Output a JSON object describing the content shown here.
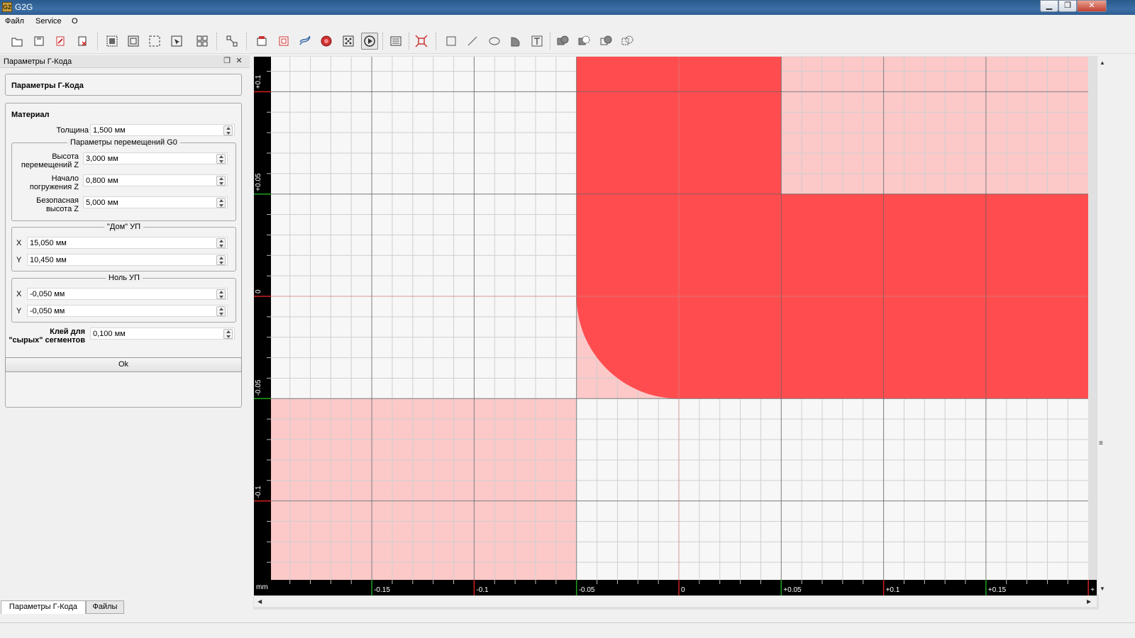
{
  "window": {
    "title": "G2G",
    "icon_text": "G2",
    "minimize": "▁",
    "maximize": "❐",
    "close": "✕"
  },
  "menu": [
    "Файл",
    "Service",
    "О"
  ],
  "toolbar_icons": [
    "open-icon",
    "save-icon",
    "export-icon",
    "delete-icon",
    "select-all-icon",
    "select-frame-icon",
    "select-dashed-icon",
    "select-arrow-icon",
    "group-icon",
    "ungroup-icon",
    "layers-icon",
    "path-icon",
    "tool-path-icon",
    "circle-target-icon",
    "points-icon",
    "gcode-params-icon",
    "properties-icon",
    "fit-view-icon",
    "rectangle-icon",
    "line-icon",
    "ellipse-icon",
    "arc-shape-icon",
    "text-icon",
    "union-icon",
    "subtract-icon",
    "intersect-icon",
    "exclude-icon"
  ],
  "dock": {
    "title": "Параметры Г-Кода",
    "header_group": "Параметры Г-Кода",
    "material": {
      "title": "Материал",
      "thickness_label": "Толщина",
      "thickness_value": "1,500 мм",
      "g0": {
        "title": "Параметры перемещений G0",
        "travel_label_1": "Высота",
        "travel_label_2": "перемещений Z",
        "travel_value": "3,000 мм",
        "plunge_label_1": "Начало",
        "plunge_label_2": "погружения Z",
        "plunge_value": "0,800 мм",
        "safe_label_1": "Безопасная",
        "safe_label_2": "высота Z",
        "safe_value": "5,000 мм"
      },
      "home": {
        "title": "\"Дом\" УП",
        "x_label": "X",
        "x_value": "15,050 мм",
        "y_label": "Y",
        "y_value": "10,450 мм"
      },
      "zero": {
        "title": "Ноль УП",
        "x_label": "X",
        "x_value": "-0,050 мм",
        "y_label": "Y",
        "y_value": "-0,050 мм"
      },
      "glue_label_1": "Клей для",
      "glue_label_2": "\"сырых\" сегментов",
      "glue_value": "0,100 мм"
    },
    "ok": "Ok",
    "float_icon": "❐",
    "close_icon": "✕"
  },
  "bottom_tabs": [
    "Параметры Г-Кода",
    "Файлы"
  ],
  "canvas": {
    "unit": "mm",
    "x_ticks": [
      {
        "label": "-0.15",
        "v": -0.15,
        "c": "green"
      },
      {
        "label": "-0.1",
        "v": -0.1,
        "c": "red"
      },
      {
        "label": "-0.05",
        "v": -0.05,
        "c": "green"
      },
      {
        "label": "0",
        "v": 0,
        "c": "red"
      },
      {
        "label": "+0.05",
        "v": 0.05,
        "c": "green"
      },
      {
        "label": "+0.1",
        "v": 0.1,
        "c": "red"
      },
      {
        "label": "+0.15",
        "v": 0.15,
        "c": "green"
      },
      {
        "label": "+",
        "v": 0.2,
        "c": "red"
      }
    ],
    "y_ticks": [
      {
        "label": "+0.1",
        "v": 0.1,
        "c": "red"
      },
      {
        "label": "+0.05",
        "v": 0.05,
        "c": "green"
      },
      {
        "label": "0",
        "v": 0,
        "c": "red"
      },
      {
        "label": "-0.05",
        "v": -0.05,
        "c": "green"
      },
      {
        "label": "-0.1",
        "v": -0.1,
        "c": "red"
      }
    ],
    "colors": {
      "background": "#f7f7f7",
      "light": "#fcc8c8",
      "solid": "#ff4d4f",
      "grid_minor": "#cfcfcf",
      "grid_major": "#606060",
      "axis": "#d08080"
    }
  }
}
